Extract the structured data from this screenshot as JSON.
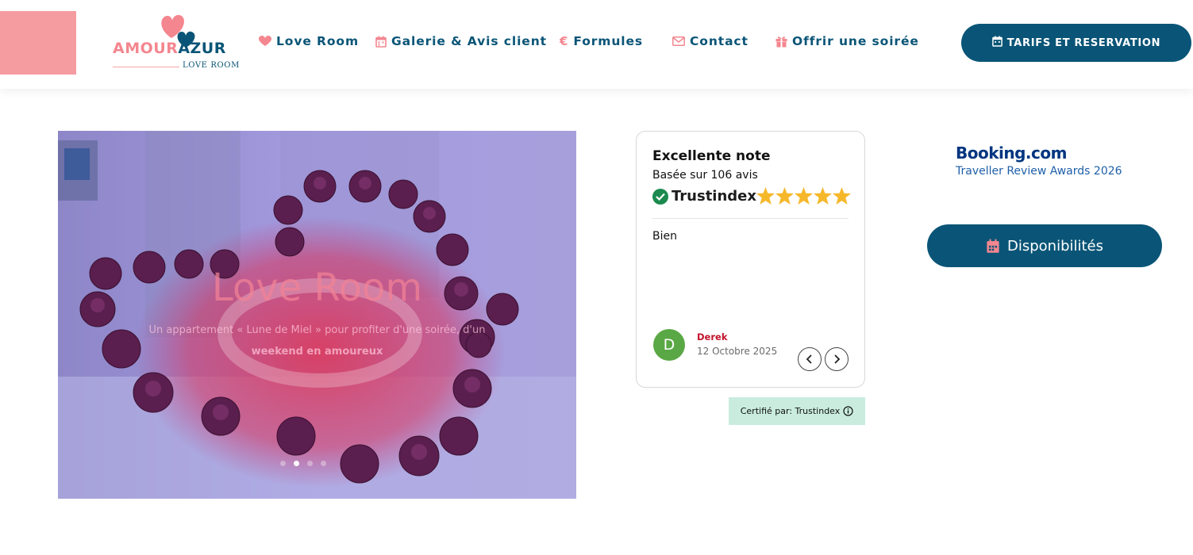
{
  "header": {
    "logo": {
      "word1": "AMOUR",
      "word2": "AZUR",
      "sub": "LOVE ROOM"
    },
    "nav": [
      {
        "label": "Love Room",
        "icon": "heart-icon"
      },
      {
        "label": "Galerie & Avis client",
        "icon": "calendar-icon"
      },
      {
        "label": "Formules",
        "icon": "euro-icon"
      },
      {
        "label": "Contact",
        "icon": "envelope-icon"
      },
      {
        "label": "Offrir une soirée",
        "icon": "gift-icon"
      }
    ],
    "cta_label": "TARIFS ET RESERVATION"
  },
  "hero": {
    "title": "Love Room",
    "subtitle_part1": "Un appartement « Lune de Miel » pour profiter d'une soirée, d'un ",
    "subtitle_bold": "weekend en amoureux",
    "slides_count": 4,
    "active_slide": 2
  },
  "review": {
    "title": "Excellente note",
    "based_on": "Basée sur 106 avis",
    "brand": "Trustindex",
    "stars": 5,
    "text": "Bien",
    "author_initial": "D",
    "author": "Derek",
    "date": "12 Octobre 2025",
    "certified": "Certifié par: Trustindex"
  },
  "booking": {
    "logo": "Booking.com",
    "award": "Traveller Review Awards 2026"
  },
  "availability_label": "Disponibilités",
  "colors": {
    "brand_blue": "#0a5577",
    "brand_pink": "#f4868f",
    "trust_green": "#1b8a4e",
    "star_gold": "#f6b82b",
    "author_red": "#c2142c"
  }
}
